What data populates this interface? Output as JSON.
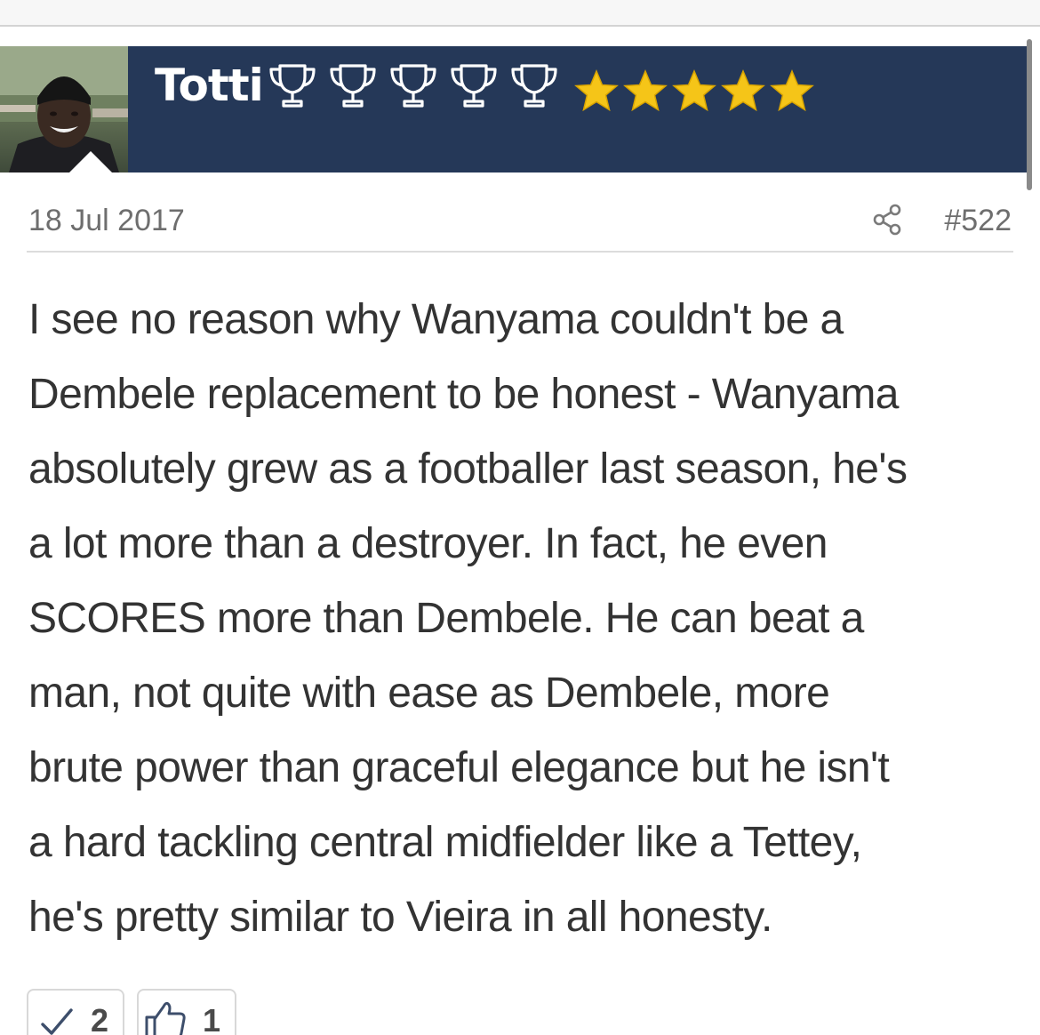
{
  "user": {
    "name": "Totti",
    "trophy_count": 5,
    "star_count": 5,
    "avatar": "profile-photo"
  },
  "post": {
    "date": "18 Jul 2017",
    "number": "#522",
    "body_lines": [
      "I see no reason why Wanyama couldn't be a",
      "Dembele replacement to be honest - Wanyama",
      "absolutely grew as a footballer last season, he's",
      "a lot more than a destroyer. In fact, he even",
      "SCORES more than Dembele. He can beat a",
      "man, not quite with ease as Dembele, more",
      "brute power than graceful elegance but he isn't",
      "a hard tackling central midfielder like a Tettey,",
      "he's pretty similar to Vieira in all honesty."
    ]
  },
  "reactions": {
    "agree": {
      "icon": "check-icon",
      "count": "2"
    },
    "like": {
      "icon": "thumbs-up-icon",
      "count": "1"
    }
  },
  "colors": {
    "header_bg": "#253858",
    "star": "#f5c518",
    "body_text": "#333333",
    "meta_text": "#6e6e6e"
  }
}
